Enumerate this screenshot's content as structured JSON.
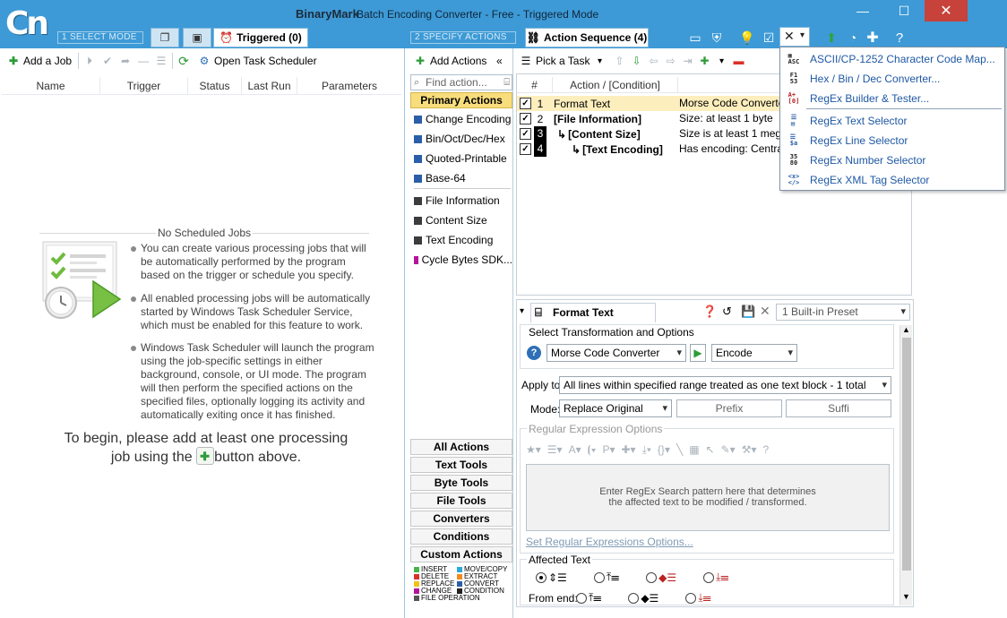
{
  "window": {
    "brand": "BinaryMark",
    "title": "Batch Encoding Converter - Free - Triggered Mode",
    "logo_text": "Cn"
  },
  "modes": {
    "step1": "1 SELECT MODE",
    "step2": "2 SPECIFY ACTIONS",
    "triggered_tab": "Triggered (0)",
    "action_sequence_tab": "Action Sequence (4)"
  },
  "left_toolbar": {
    "add_job": "Add a Job",
    "open_scheduler": "Open Task Scheduler"
  },
  "job_table": {
    "columns": [
      "Name",
      "Trigger",
      "Status",
      "Last Run",
      "Parameters"
    ]
  },
  "empty_state": {
    "heading": "No Scheduled Jobs",
    "bullets": [
      "You can create various processing jobs that will be automatically performed by the program based on the trigger or schedule you specify.",
      "All enabled processing jobs will be automatically started by Windows Task Scheduler Service, which must be enabled for this feature to work.",
      "Windows Task Scheduler will launch the program using the job-specific settings in either background, console, or UI mode. The program will then perform the specified actions on the specified files, optionally logging its activity and automatically exiting once it has finished."
    ],
    "begin_part1": "To begin, please add at least one processing",
    "begin_part2a": "job using the",
    "begin_part2b": "button above."
  },
  "actions_panel": {
    "add_actions": "Add Actions",
    "find_placeholder": "Find action...",
    "primary_header": "Primary Actions",
    "group1": [
      {
        "label": "Change Encoding",
        "color": "#2a5ea8"
      },
      {
        "label": "Bin/Oct/Dec/Hex",
        "color": "#2a5ea8"
      },
      {
        "label": "Quoted-Printable",
        "color": "#2a5ea8"
      },
      {
        "label": "Base-64",
        "color": "#2a5ea8"
      }
    ],
    "group2": [
      {
        "label": "File Information",
        "color": "#3c3c3c"
      },
      {
        "label": "Content Size",
        "color": "#3c3c3c"
      },
      {
        "label": "Text Encoding",
        "color": "#3c3c3c"
      },
      {
        "label": "Cycle Bytes SDK...",
        "color": "#b5159a"
      }
    ],
    "categories": [
      "All Actions",
      "Text Tools",
      "Byte Tools",
      "File Tools",
      "Converters",
      "Conditions",
      "Custom Actions"
    ],
    "legend": [
      {
        "label": "INSERT",
        "color": "#46b648"
      },
      {
        "label": "MOVE/COPY",
        "color": "#29a9d8"
      },
      {
        "label": "DELETE",
        "color": "#d9322b"
      },
      {
        "label": "EXTRACT",
        "color": "#f08a24"
      },
      {
        "label": "REPLACE",
        "color": "#f2c218"
      },
      {
        "label": "CONVERT",
        "color": "#2a5ea8"
      },
      {
        "label": "CHANGE",
        "color": "#b5159a"
      },
      {
        "label": "CONDITION",
        "color": "#222222"
      },
      {
        "label": "FILE OPERATION",
        "color": "#555555"
      }
    ]
  },
  "right_toolbar": {
    "pick_task": "Pick a Task"
  },
  "sequence": {
    "columns": [
      "#",
      "Action / [Condition]"
    ],
    "rows": [
      {
        "num": "1",
        "action": "Format Text",
        "cond": "Morse Code Converter"
      },
      {
        "num": "2",
        "action": "[File Information]",
        "cond": "Size: at least 1 byte"
      },
      {
        "num": "3",
        "action": "[Content Size]",
        "cond": "Size is at least 1 megabyte"
      },
      {
        "num": "4",
        "action": "[Text Encoding]",
        "cond": "Has encoding: Central"
      }
    ]
  },
  "format_options": {
    "tab_title": "Format Text Options",
    "preset": "1 Built-in Preset",
    "select_group": "Select Transformation and Options",
    "transformation": "Morse Code Converter",
    "direction": "Encode",
    "apply_to_label": "Apply to:",
    "apply_to_value": "All lines within specified range treated as one text block - 1 total",
    "mode_label": "Mode:",
    "mode_value": "Replace Original",
    "prefix": "Prefix",
    "suffix": "Suffi",
    "regex_group": "Regular Expression Options",
    "regex_placeholder_l1": "Enter RegEx Search pattern here that determines",
    "regex_placeholder_l2": "the affected text to be modified / transformed.",
    "set_regex_link": "Set Regular Expressions Options...",
    "affected_group": "Affected Text",
    "from_end": "From end:"
  },
  "tools_menu": {
    "items": [
      {
        "label": "ASCII/CP-1252 Character Code Map...",
        "icon": "ascii-map-icon"
      },
      {
        "label": "Hex / Bin / Dec Converter...",
        "icon": "hex-converter-icon"
      },
      {
        "label": "RegEx Builder & Tester...",
        "icon": "regex-builder-icon"
      },
      {
        "label": "RegEx Text Selector",
        "icon": "regex-text-icon"
      },
      {
        "label": "RegEx Line Selector",
        "icon": "regex-line-icon"
      },
      {
        "label": "RegEx Number Selector",
        "icon": "regex-number-icon"
      },
      {
        "label": "RegEx XML Tag Selector",
        "icon": "regex-xml-icon"
      }
    ]
  },
  "colors": {
    "titlebar": "#3d9ad6",
    "highlight_row": "#fdeebd",
    "primary_header": "#f8dd7c",
    "menu_text": "#1f58a3",
    "close_button": "#c7423a"
  }
}
